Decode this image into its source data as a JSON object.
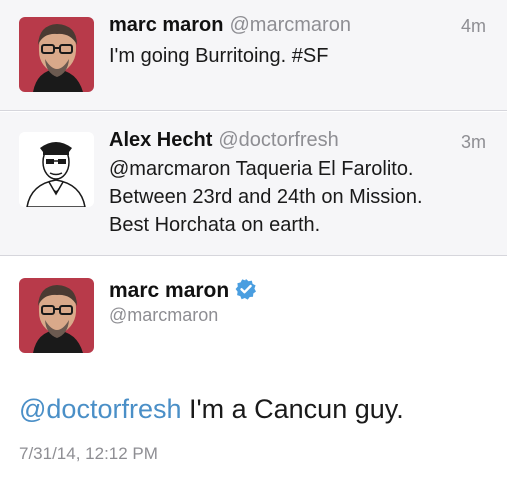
{
  "tweets": [
    {
      "name": "marc maron",
      "handle": "@marcmaron",
      "time": "4m",
      "lines": [
        "I'm going Burritoing. #SF"
      ]
    },
    {
      "name": "Alex Hecht",
      "handle": "@doctorfresh",
      "time": "3m",
      "lines": [
        "@marcmaron Taqueria El Farolito.",
        "Between 23rd and 24th on Mission.",
        "Best Horchata on earth."
      ]
    }
  ],
  "main_tweet": {
    "name": "marc maron",
    "handle": "@marcmaron",
    "verified": true,
    "mention": "@doctorfresh",
    "text": " I'm a Cancun guy.",
    "date": "7/31/14, 12:12 PM"
  },
  "icons": {
    "verified": "verified-badge-icon"
  },
  "colors": {
    "mention": "#4a8fc7",
    "verified": "#4a9ee0",
    "secondary_text": "#8e8e93",
    "reply_background": "#f6f6f8"
  }
}
